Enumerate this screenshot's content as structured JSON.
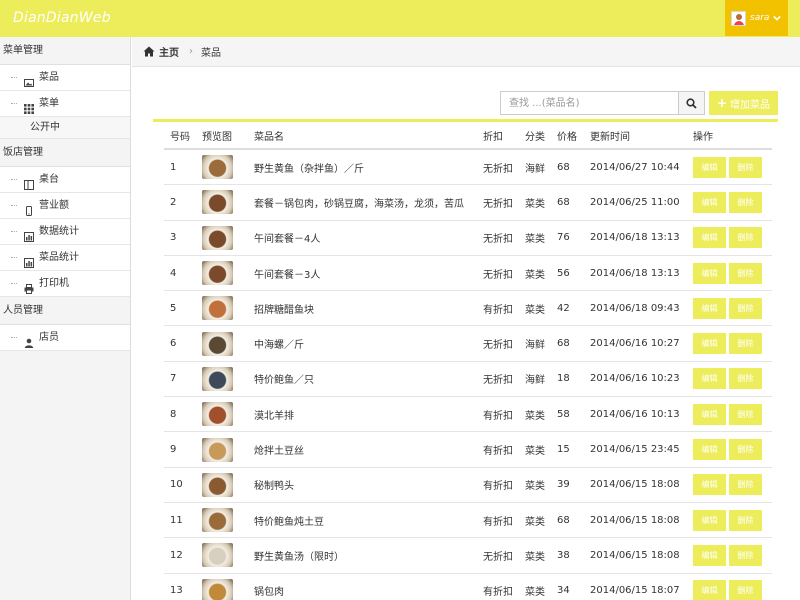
{
  "app": {
    "brand": "DianDianWeb",
    "user": "sara"
  },
  "sidebar": {
    "groups": [
      {
        "title": "菜单管理",
        "items": [
          {
            "label": "菜品",
            "icon": "image-icon"
          },
          {
            "label": "菜单",
            "icon": "grid-icon"
          }
        ],
        "sub": [
          "公开中"
        ]
      },
      {
        "title": "饭店管理",
        "items": [
          {
            "label": "桌台",
            "icon": "table-layout-icon"
          },
          {
            "label": "营业额",
            "icon": "phone-icon"
          },
          {
            "label": "数据统计",
            "icon": "bar-chart-icon"
          },
          {
            "label": "菜品统计",
            "icon": "bar-chart-icon"
          },
          {
            "label": "打印机",
            "icon": "printer-icon"
          }
        ]
      },
      {
        "title": "人员管理",
        "items": [
          {
            "label": "店员",
            "icon": "user-icon"
          }
        ]
      }
    ]
  },
  "breadcrumb": {
    "home": "主页",
    "current": "菜品"
  },
  "search": {
    "placeholder": "查找 ...(菜品名)"
  },
  "toolbar": {
    "add_label": "增加菜品"
  },
  "colors": {
    "accent": "#eded5c",
    "user_menu": "#f2c200"
  },
  "table": {
    "headers": {
      "num": "号码",
      "thumb": "预览图",
      "name": "菜品名",
      "discount": "折扣",
      "category": "分类",
      "price": "价格",
      "time": "更新时间",
      "ops": "操作"
    },
    "edit_label": "编辑",
    "delete_label": "删除",
    "rows": [
      {
        "num": "1",
        "name": "野生黄鱼（杂拌鱼）／斤",
        "discount": "无折扣",
        "category": "海鲜",
        "price": "68",
        "time": "2014/06/27 10:44",
        "thumb_color": "#9c6b3c"
      },
      {
        "num": "2",
        "name": "套餐－锅包肉，砂锅豆腐，海菜汤，龙须，苦瓜",
        "discount": "无折扣",
        "category": "菜类",
        "price": "68",
        "time": "2014/06/25 11:00",
        "thumb_color": "#7a4a2a"
      },
      {
        "num": "3",
        "name": "午间套餐－4人",
        "discount": "无折扣",
        "category": "菜类",
        "price": "76",
        "time": "2014/06/18 13:13",
        "thumb_color": "#7a4a2a"
      },
      {
        "num": "4",
        "name": "午间套餐－3人",
        "discount": "无折扣",
        "category": "菜类",
        "price": "56",
        "time": "2014/06/18 13:13",
        "thumb_color": "#7a4a2a"
      },
      {
        "num": "5",
        "name": "招牌糖醋鱼块",
        "discount": "有折扣",
        "category": "菜类",
        "price": "42",
        "time": "2014/06/18 09:43",
        "thumb_color": "#c0703a"
      },
      {
        "num": "6",
        "name": "中海螺／斤",
        "discount": "无折扣",
        "category": "海鲜",
        "price": "68",
        "time": "2014/06/16 10:27",
        "thumb_color": "#5a4a34"
      },
      {
        "num": "7",
        "name": "特价鲍鱼／只",
        "discount": "无折扣",
        "category": "海鲜",
        "price": "18",
        "time": "2014/06/16 10:23",
        "thumb_color": "#3e4a5a"
      },
      {
        "num": "8",
        "name": "漠北羊排",
        "discount": "有折扣",
        "category": "菜类",
        "price": "58",
        "time": "2014/06/16 10:13",
        "thumb_color": "#a0502a"
      },
      {
        "num": "9",
        "name": "炝拌土豆丝",
        "discount": "有折扣",
        "category": "菜类",
        "price": "15",
        "time": "2014/06/15 23:45",
        "thumb_color": "#c89a5a"
      },
      {
        "num": "10",
        "name": "秘制鸭头",
        "discount": "有折扣",
        "category": "菜类",
        "price": "39",
        "time": "2014/06/15 18:08",
        "thumb_color": "#8a5a30"
      },
      {
        "num": "11",
        "name": "特价鲍鱼炖土豆",
        "discount": "有折扣",
        "category": "菜类",
        "price": "68",
        "time": "2014/06/15 18:08",
        "thumb_color": "#9a6a3a"
      },
      {
        "num": "12",
        "name": "野生黄鱼汤（限时）",
        "discount": "无折扣",
        "category": "菜类",
        "price": "38",
        "time": "2014/06/15 18:08",
        "thumb_color": "#d8cfc0"
      },
      {
        "num": "13",
        "name": "锅包肉",
        "discount": "有折扣",
        "category": "菜类",
        "price": "34",
        "time": "2014/06/15 18:07",
        "thumb_color": "#c08a3a"
      }
    ]
  }
}
